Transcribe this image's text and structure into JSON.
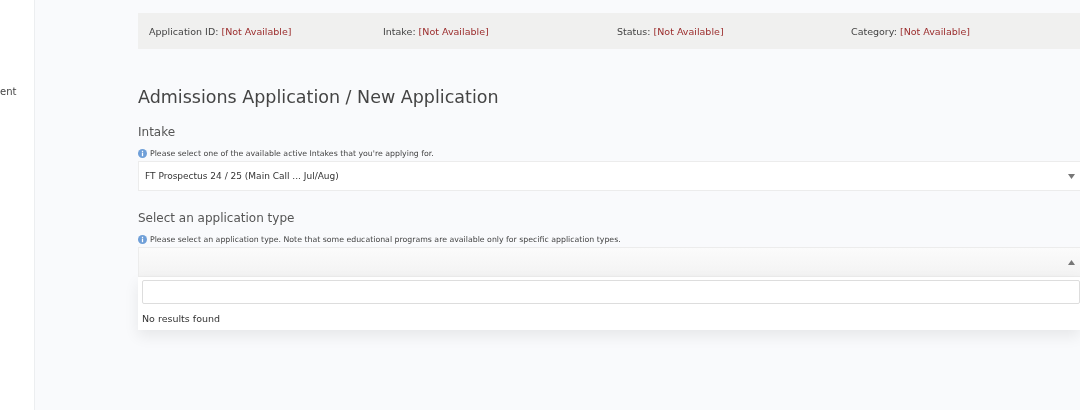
{
  "sidebar": {
    "items": [
      {
        "label": "ent"
      }
    ]
  },
  "info_bar": [
    {
      "label": "Application ID:",
      "value": "[Not Available]"
    },
    {
      "label": "Intake:",
      "value": "[Not Available]"
    },
    {
      "label": "Status:",
      "value": "[Not Available]"
    },
    {
      "label": "Category:",
      "value": "[Not Available]"
    }
  ],
  "page_title": "Admissions Application / New Application",
  "fields": [
    {
      "label": "Intake",
      "hint": "Please select one of the available active Intakes that you're applying for.",
      "value": "FT Prospectus 24 / 25 (Main Call ... Jul/Aug)",
      "expanded": false
    },
    {
      "label": "Select an application type",
      "hint": "Please select an application type. Note that some educational programs are available only for specific application types.",
      "expanded": true,
      "dropdown": {
        "message": "No results found"
      }
    }
  ]
}
